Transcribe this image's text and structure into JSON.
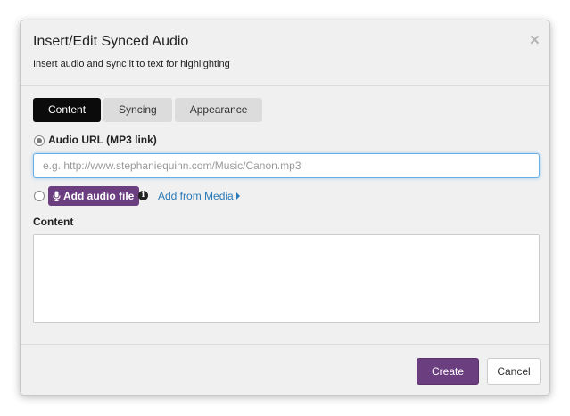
{
  "dialog": {
    "title": "Insert/Edit Synced Audio",
    "subtitle": "Insert audio and sync it to text for highlighting",
    "close_glyph": "×"
  },
  "tabs": [
    {
      "label": "Content",
      "active": true
    },
    {
      "label": "Syncing",
      "active": false
    },
    {
      "label": "Appearance",
      "active": false
    }
  ],
  "audio_url": {
    "label": "Audio URL (MP3 link)",
    "selected": true,
    "placeholder": "e.g. http://www.stephaniequinn.com/Music/Canon.mp3",
    "value": ""
  },
  "audio_file": {
    "selected": false,
    "button_label": "Add audio file",
    "button_icon": "microphone-icon",
    "info_icon": "info-icon",
    "media_link_label": "Add from Media",
    "media_link_icon": "caret-right-icon"
  },
  "content": {
    "label": "Content",
    "value": ""
  },
  "footer": {
    "create_label": "Create",
    "cancel_label": "Cancel"
  },
  "colors": {
    "accent": "#6b3e7f",
    "active_tab": "#0b0b0b",
    "link": "#2a7ab8",
    "focus_border": "#66afe9"
  }
}
